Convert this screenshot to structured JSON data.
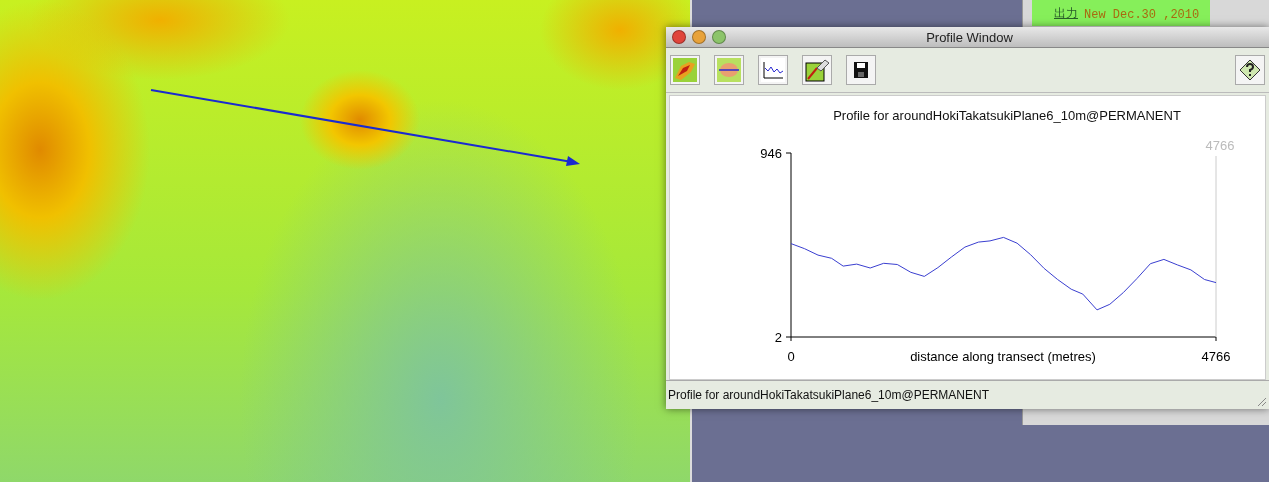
{
  "note": {
    "link": "出力",
    "text": "New Dec.30 ,2010"
  },
  "window": {
    "title": "Profile Window"
  },
  "chart_data": {
    "type": "line",
    "title": "Profile for aroundHokiTakatsukiPlane6_10m@PERMANENT",
    "xlabel": "distance along transect (metres)",
    "xlim": [
      0,
      4766
    ],
    "ylim": [
      2,
      946
    ],
    "xticks": [
      0,
      4766
    ],
    "yticks": [
      2,
      946
    ],
    "x": [
      0,
      152,
      303,
      455,
      585,
      737,
      888,
      1040,
      1192,
      1343,
      1495,
      1647,
      1798,
      1950,
      2102,
      2232,
      2383,
      2535,
      2687,
      2838,
      2990,
      3142,
      3272,
      3432,
      3575,
      3727,
      3878,
      4030,
      4182,
      4333,
      4485,
      4637,
      4766
    ],
    "series": [
      {
        "color": "#3a3fd0",
        "values": [
          481,
          455,
          422,
          406,
          366,
          376,
          356,
          380,
          374,
          334,
          313,
          358,
          412,
          463,
          489,
          495,
          513,
          483,
          424,
          354,
          297,
          247,
          222,
          141,
          170,
          230,
          301,
          378,
          400,
          372,
          346,
          297,
          281
        ]
      }
    ],
    "annotations": [
      "4766"
    ]
  },
  "status_bar": "Profile for aroundHokiTakatsukiPlane6_10m@PERMANENT"
}
